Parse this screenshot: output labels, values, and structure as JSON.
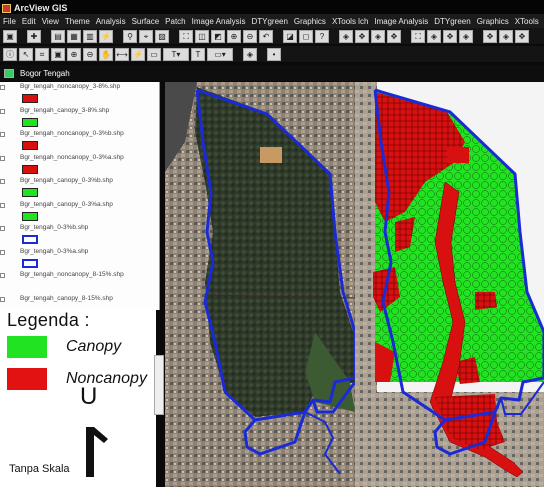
{
  "window": {
    "title": "ArcView GIS"
  },
  "menu": [
    {
      "label": "File",
      "underline": "F"
    },
    {
      "label": "Edit"
    },
    {
      "label": "View"
    },
    {
      "label": "Theme"
    },
    {
      "label": "Analysis"
    },
    {
      "label": "Surface"
    },
    {
      "label": "Patch"
    },
    {
      "label": "Image Analysis"
    },
    {
      "label": "DTYgreen"
    },
    {
      "label": "Graphics"
    },
    {
      "label": "XTools lch"
    },
    {
      "label": "Image Analysis"
    },
    {
      "label": "DTYgreen"
    },
    {
      "label": "Graphics"
    },
    {
      "label": "XTools"
    }
  ],
  "document": {
    "title": "Bogor Tengah"
  },
  "toc": {
    "themes": [
      {
        "name": "Bgr_tengah_noncanopy_3-8%.shp",
        "symbol": "red-fill"
      },
      {
        "name": "Bgr_tengah_canopy_3-8%.shp",
        "symbol": "green-fill"
      },
      {
        "name": "Bgr_tengah_noncanopy_0-3%b.shp",
        "symbol": "red-fill"
      },
      {
        "name": "Bgr_tengah_noncanopy_0-3%a.shp",
        "symbol": "red-fill"
      },
      {
        "name": "Bgr_tengah_canopy_0-3%b.shp",
        "symbol": "green-fill"
      },
      {
        "name": "Bgr_tengah_canopy_0-3%a.shp",
        "symbol": "green-fill"
      },
      {
        "name": "Bgr_tengah_0-3%b.shp",
        "symbol": "blue-outline"
      },
      {
        "name": "Bgr_tengah_0-3%a.shp",
        "symbol": "blue-outline"
      },
      {
        "name": "Bgr_tengah_noncanopy_8-15%.shp",
        "symbol": "none"
      },
      {
        "name": "Bgr_tengah_canopy_8-15%.shp",
        "symbol": "none"
      }
    ]
  },
  "legend": {
    "title": "Legenda :",
    "items": [
      {
        "label": "Canopy",
        "color": "#22e322"
      },
      {
        "label": "Noncanopy",
        "color": "#e31212"
      }
    ],
    "north_letter": "U",
    "scale_note": "Tanpa Skala"
  },
  "colors": {
    "canopy": "#22e322",
    "noncanopy": "#d81010",
    "boundary": "#1a2bd6"
  },
  "icons": {
    "north_arrow": "north-arrow-icon"
  }
}
